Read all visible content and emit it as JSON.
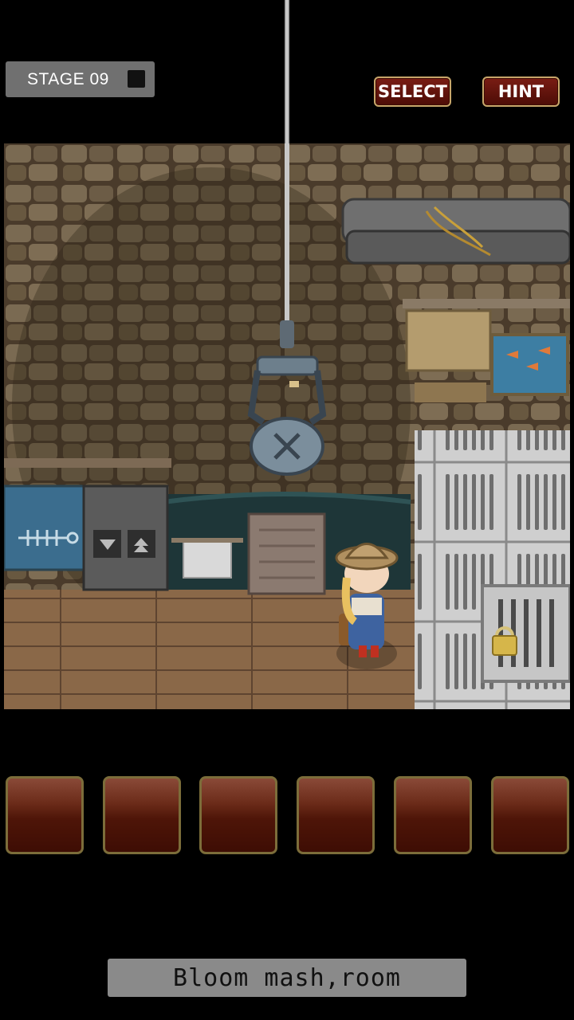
{
  "header": {
    "stage_label": "STAGE 09",
    "select_label": "SELECT",
    "hint_label": "HINT"
  },
  "inventory": {
    "slots": [
      "",
      "",
      "",
      "",
      "",
      ""
    ]
  },
  "footer": {
    "room_name": "Bloom mash,room"
  },
  "colors": {
    "button_fill": "#5e1209",
    "button_border": "#c7a66a",
    "slot_fill": "#4e1508",
    "badge_fill": "#707070",
    "room_bar": "#8a8a8a"
  },
  "icons": [
    "crane-claw-icon",
    "padlock-icon",
    "fish-skeleton-icon",
    "down-arrow-icon",
    "up-arrow-icon"
  ]
}
